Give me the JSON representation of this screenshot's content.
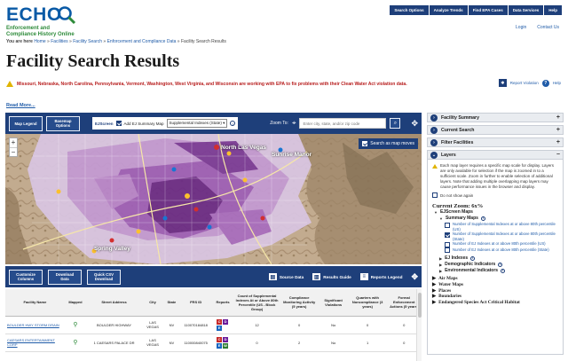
{
  "header": {
    "logo_word": "ECHO",
    "logo_sub_1": "Enforcement and",
    "logo_sub_2": "Compliance History Online",
    "breadcrumb_prefix": "You are here",
    "breadcrumb": [
      "Home",
      "Facilities",
      "Facility Search",
      "Enforcement and Compliance Data",
      "Facility Search Results"
    ],
    "nav": [
      "Search Options",
      "Analyze Trends",
      "Find EPA Cases",
      "Data Services",
      "Help"
    ],
    "links": [
      "Login",
      "Contact Us"
    ]
  },
  "page": {
    "title": "Facility Search Results",
    "report_violation": "Report Violation",
    "help": "Help",
    "alert": "Missouri, Nebraska, North Carolina, Pennsylvania, Vermont, Washington, West Virginia, and Wisconsin are working with EPA to fix problems with their Clean Water Act violation data.",
    "read_more": "Read More..."
  },
  "map_toolbar": {
    "map_legend": "Map Legend",
    "basemap_options": "Basemap Options",
    "ejscreen_label": "EJScreen",
    "ej_summary_label": "Add EJ Summary Map",
    "ej_select_value": "Supplemental Indexes (State)",
    "zoom_to_label": "Zoom To:",
    "zoom_placeholder": "Enter city, state, and/or zip code"
  },
  "map": {
    "search_as_map_moves": "Search as map moves",
    "zoom_in": "+",
    "zoom_out": "−",
    "cities": [
      "North Las Vegas",
      "Sunrise Manor",
      "Spring Valley"
    ]
  },
  "bottom_toolbar": {
    "customize_columns": "Customize Columns",
    "download_data": "Download Data",
    "quick_csv": "Quick CSV Download",
    "source_data": "Source Data",
    "results_guide": "Results Guide",
    "reports_legend": "Reports Legend"
  },
  "table": {
    "headers": [
      "Facility Name",
      "Mapped",
      "Street Address",
      "City",
      "State",
      "FRS ID",
      "Reports",
      "Count of Supplemental Indexes At or Above 80th Percentile (US - Block Group)",
      "Compliance Monitoring Activity (5 years)",
      "Significant Violations",
      "Quarters with Noncompliance (3 years)",
      "Formal Enforcement Actions (5 years)"
    ],
    "rows": [
      {
        "name": "BOULDER HWY STORM DRAIN",
        "address": "BOULDER HIGHWAY",
        "city": "LAS VEGAS",
        "state": "NV",
        "frs": "110070184818",
        "count": "12",
        "monitoring": "0",
        "violations": "No",
        "quarters": "0",
        "actions": "0"
      },
      {
        "name": "CAESARS ENTERTAINMENT CORP",
        "address": "1 CAESARS PALACE DR",
        "city": "LAS VEGAS",
        "state": "NV",
        "frs": "110000840075",
        "count": "0",
        "monitoring": "2",
        "violations": "No",
        "quarters": "1",
        "actions": "0"
      }
    ]
  },
  "side_panel": {
    "facility_summary": "Facility Summary",
    "current_search": "Current Search",
    "filter_facilities": "Filter Facilities",
    "layers": "Layers",
    "layers_note": "Each map layer requires a specific map scale for display. Layers are only available for selection if the map is zoomed in to a sufficient scale. Zoom in further to enable selection of additional layers. Note that adding multiple overlapping map layers may cause performance issues in the browser and display.",
    "dont_show_again": "Do not show again",
    "current_zoom": "Current Zoom: 6x%",
    "ejscreen_maps": "EJScreen Maps",
    "summary_maps": "Summary Maps",
    "summary_options": [
      {
        "label": "Number of Supplemental Indexes at or above 80th percentile (US)",
        "checked": false
      },
      {
        "label": "Number of Supplemental Indexes at or above 80th percentile (State)",
        "checked": true
      },
      {
        "label": "Number of EJ Indexes at or above 80th percentile (US)",
        "checked": false
      },
      {
        "label": "Number of EJ Indexes at or above 80th percentile (State)",
        "checked": false
      }
    ],
    "ej_indexes": "EJ Indexes",
    "demographic_indicators": "Demographic Indicators",
    "environmental_indicators": "Environmental Indicators",
    "other_layers": [
      "Air Maps",
      "Water Maps",
      "Places",
      "Boundaries",
      "Endangered Species Act Critical Habitat"
    ]
  },
  "colors": {
    "navy": "#1e3f7a",
    "alert_red": "#b71c1c",
    "link_blue": "#1f5ba8",
    "ej_purple": "#6b2a86"
  }
}
